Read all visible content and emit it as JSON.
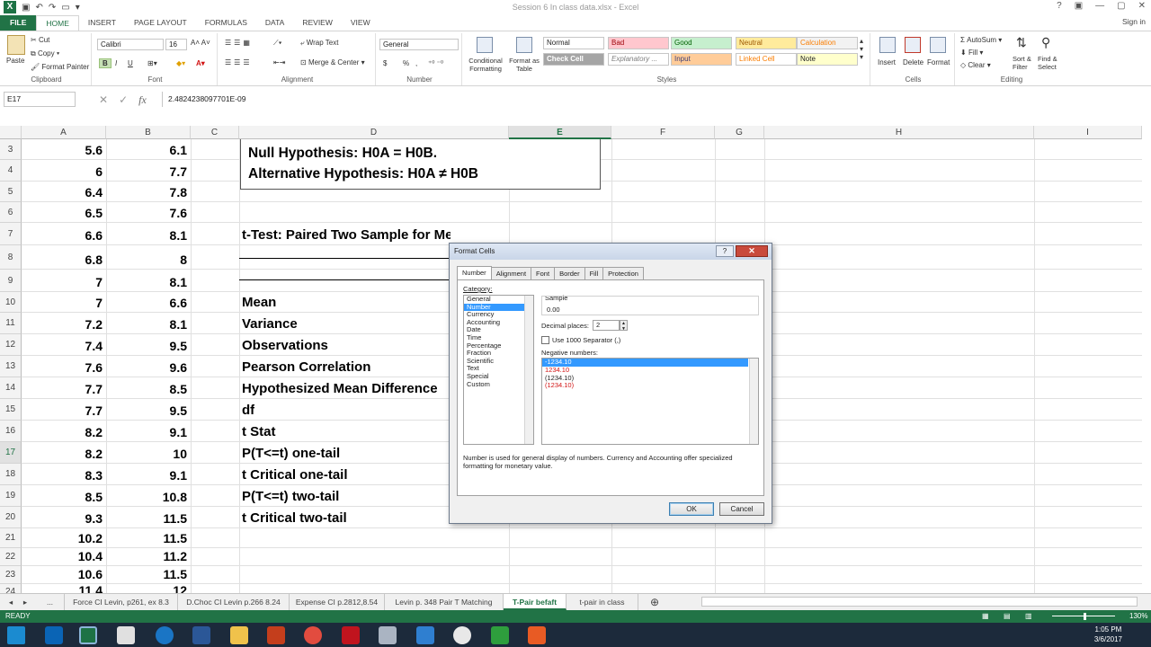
{
  "window": {
    "title": "Session 6 In class data.xlsx - Excel",
    "sign_in": "Sign in"
  },
  "ribbon_tabs": [
    "FILE",
    "HOME",
    "INSERT",
    "PAGE LAYOUT",
    "FORMULAS",
    "DATA",
    "REVIEW",
    "VIEW"
  ],
  "ribbon": {
    "clipboard": {
      "paste": "Paste",
      "cut": "Cut",
      "copy": "Copy",
      "format_painter": "Format Painter",
      "label": "Clipboard"
    },
    "font": {
      "name": "Calibri",
      "size": "16",
      "bold": "B",
      "italic": "I",
      "underline": "U",
      "label": "Font"
    },
    "alignment": {
      "wrap_text": "Wrap Text",
      "merge_center": "Merge & Center",
      "label": "Alignment"
    },
    "number": {
      "format": "General",
      "currency": "$",
      "percent": "%",
      "comma": ",",
      "label": "Number"
    },
    "styles": {
      "conditional": "Conditional Formatting",
      "format_as_table": "Format as Table",
      "cells": [
        {
          "name": "Normal",
          "bg": "#ffffff",
          "fg": "#222222"
        },
        {
          "name": "Bad",
          "bg": "#ffc7ce",
          "fg": "#9c0006"
        },
        {
          "name": "Good",
          "bg": "#c6efce",
          "fg": "#006100"
        },
        {
          "name": "Neutral",
          "bg": "#ffeb9c",
          "fg": "#9c5700"
        },
        {
          "name": "Calculation",
          "bg": "#f2f2f2",
          "fg": "#fa7d00"
        },
        {
          "name": "Check Cell",
          "bg": "#a5a5a5",
          "fg": "#ffffff"
        },
        {
          "name": "Explanatory ...",
          "bg": "#ffffff",
          "fg": "#7f7f7f"
        },
        {
          "name": "Input",
          "bg": "#ffcc99",
          "fg": "#3f3f76"
        },
        {
          "name": "Linked Cell",
          "bg": "#ffffff",
          "fg": "#fa7d00"
        },
        {
          "name": "Note",
          "bg": "#ffffcc",
          "fg": "#222222"
        }
      ],
      "label": "Styles"
    },
    "cells": {
      "insert": "Insert",
      "delete": "Delete",
      "format": "Format",
      "label": "Cells"
    },
    "editing": {
      "autosum": "AutoSum",
      "fill": "Fill",
      "clear": "Clear",
      "sort_filter": "Sort & Filter",
      "find_select": "Find & Select",
      "label": "Editing"
    }
  },
  "formula_bar": {
    "name_box": "E17",
    "fx": "fx",
    "value": "2.4824238097701E-09"
  },
  "columns": [
    "A",
    "B",
    "C",
    "D",
    "E",
    "F",
    "G",
    "H",
    "I"
  ],
  "rows": [
    {
      "n": "3",
      "a": "5.6",
      "b": "6.1",
      "d": "Null Hypothesis: H0A = H0B."
    },
    {
      "n": "4",
      "a": "6",
      "b": "7.7",
      "d": "Alternative Hypothesis: H0A ≠ H0B"
    },
    {
      "n": "5",
      "a": "6.4",
      "b": "7.8",
      "d": ""
    },
    {
      "n": "6",
      "a": "6.5",
      "b": "7.6",
      "d": ""
    },
    {
      "n": "7",
      "a": "6.6",
      "b": "8.1",
      "d": "t-Test: Paired Two Sample for Means"
    },
    {
      "n": "8",
      "a": "6.8",
      "b": "8",
      "d": ""
    },
    {
      "n": "9",
      "a": "7",
      "b": "8.1",
      "d": ""
    },
    {
      "n": "10",
      "a": "7",
      "b": "6.6",
      "d": "Mean"
    },
    {
      "n": "11",
      "a": "7.2",
      "b": "8.1",
      "d": "Variance"
    },
    {
      "n": "12",
      "a": "7.4",
      "b": "9.5",
      "d": "Observations"
    },
    {
      "n": "13",
      "a": "7.6",
      "b": "9.6",
      "d": "Pearson Correlation"
    },
    {
      "n": "14",
      "a": "7.7",
      "b": "8.5",
      "d": "Hypothesized Mean Difference"
    },
    {
      "n": "15",
      "a": "7.7",
      "b": "9.5",
      "d": "df"
    },
    {
      "n": "16",
      "a": "8.2",
      "b": "9.1",
      "d": "t Stat"
    },
    {
      "n": "17",
      "a": "8.2",
      "b": "10",
      "d": "P(T<=t) one-tail"
    },
    {
      "n": "18",
      "a": "8.3",
      "b": "9.1",
      "d": "t Critical one-tail"
    },
    {
      "n": "19",
      "a": "8.5",
      "b": "10.8",
      "d": "P(T<=t) two-tail"
    },
    {
      "n": "20",
      "a": "9.3",
      "b": "11.5",
      "d": "t Critical two-tail"
    },
    {
      "n": "21",
      "a": "10.2",
      "b": "11.5",
      "d": ""
    },
    {
      "n": "22",
      "a": "10.4",
      "b": "11.2",
      "d": ""
    },
    {
      "n": "23",
      "a": "10.6",
      "b": "11.5",
      "d": ""
    },
    {
      "n": "24",
      "a": "11.4",
      "b": "12",
      "d": ""
    }
  ],
  "sheet_tabs": [
    "...",
    "Force CI Levin, p261, ex 8.3",
    "D.Choc CI Levin p.266 8.24",
    "Expense CI p.2812,8.54",
    "Levin p. 348 Pair T Matching",
    "T-Pair befaft",
    "t-pair in class"
  ],
  "active_sheet": "T-Pair befaft",
  "status": {
    "ready": "READY",
    "zoom": "130%"
  },
  "clock": {
    "time": "1:05 PM",
    "date": "3/6/2017"
  },
  "dialog": {
    "title": "Format Cells",
    "help": "?",
    "close": "✕",
    "tabs": [
      "Number",
      "Alignment",
      "Font",
      "Border",
      "Fill",
      "Protection"
    ],
    "category_label": "Category:",
    "categories": [
      "General",
      "Number",
      "Currency",
      "Accounting",
      "Date",
      "Time",
      "Percentage",
      "Fraction",
      "Scientific",
      "Text",
      "Special",
      "Custom"
    ],
    "selected_category": "Number",
    "sample_label": "Sample",
    "sample_value": "0.00",
    "decimal_label": "Decimal places:",
    "decimal_value": "2",
    "separator_label": "Use 1000 Separator (,)",
    "negative_label": "Negative numbers:",
    "negative_options": [
      "-1234.10",
      "1234.10",
      "(1234.10)",
      "(1234.10)"
    ],
    "description": "Number is used for general display of numbers.  Currency and Accounting offer specialized formatting for monetary value.",
    "ok": "OK",
    "cancel": "Cancel"
  }
}
